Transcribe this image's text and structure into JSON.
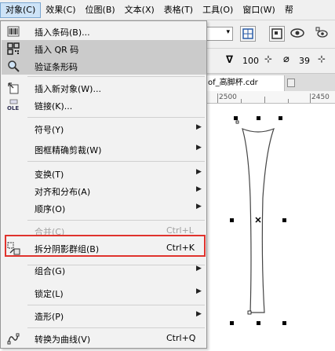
{
  "menubar": {
    "items": [
      {
        "label": "对象(C)",
        "active": true
      },
      {
        "label": "效果(C)"
      },
      {
        "label": "位图(B)"
      },
      {
        "label": "文本(X)"
      },
      {
        "label": "表格(T)"
      },
      {
        "label": "工具(O)"
      },
      {
        "label": "窗口(W)"
      },
      {
        "label": "帮"
      }
    ]
  },
  "toolbar": {
    "outline_width": "100",
    "angle": "39"
  },
  "document": {
    "tab_title": "of_高脚杯.cdr",
    "ruler_labels": [
      "2500",
      "2450"
    ]
  },
  "menu": {
    "items": [
      {
        "label": "插入条码(B)...",
        "icon": "barcode-icon"
      },
      {
        "label": "插入 QR 码",
        "icon": "qr-code-icon",
        "highlight": true
      },
      {
        "label": "验证条形码",
        "icon": "magnifier-icon",
        "highlight": true
      },
      {
        "label": "插入新对象(W)...",
        "icon": "insert-object-icon"
      },
      {
        "label": "链接(K)...",
        "icon": "ole-link-icon"
      },
      {
        "label": "符号(Y)",
        "submenu": true
      },
      {
        "label": "图框精确剪裁(W)",
        "submenu": true
      },
      {
        "label": "变换(T)",
        "submenu": true
      },
      {
        "label": "对齐和分布(A)",
        "submenu": true
      },
      {
        "label": "顺序(O)",
        "submenu": true
      },
      {
        "label": "合并(C)",
        "shortcut": "Ctrl+L",
        "disabled": true,
        "icon": "combine-icon"
      },
      {
        "label": "拆分阴影群组(B)",
        "shortcut": "Ctrl+K",
        "icon": "break-apart-icon",
        "boxed": true
      },
      {
        "label": "组合(G)",
        "submenu": true
      },
      {
        "label": "锁定(L)",
        "submenu": true
      },
      {
        "label": "造形(P)",
        "submenu": true
      },
      {
        "label": "转换为曲线(V)",
        "shortcut": "Ctrl+Q",
        "icon": "convert-curves-icon"
      }
    ]
  },
  "colors": {
    "highlight": "#cbcbcb",
    "red_box": "#e0332d",
    "menubar_active": "#cde3f7"
  }
}
